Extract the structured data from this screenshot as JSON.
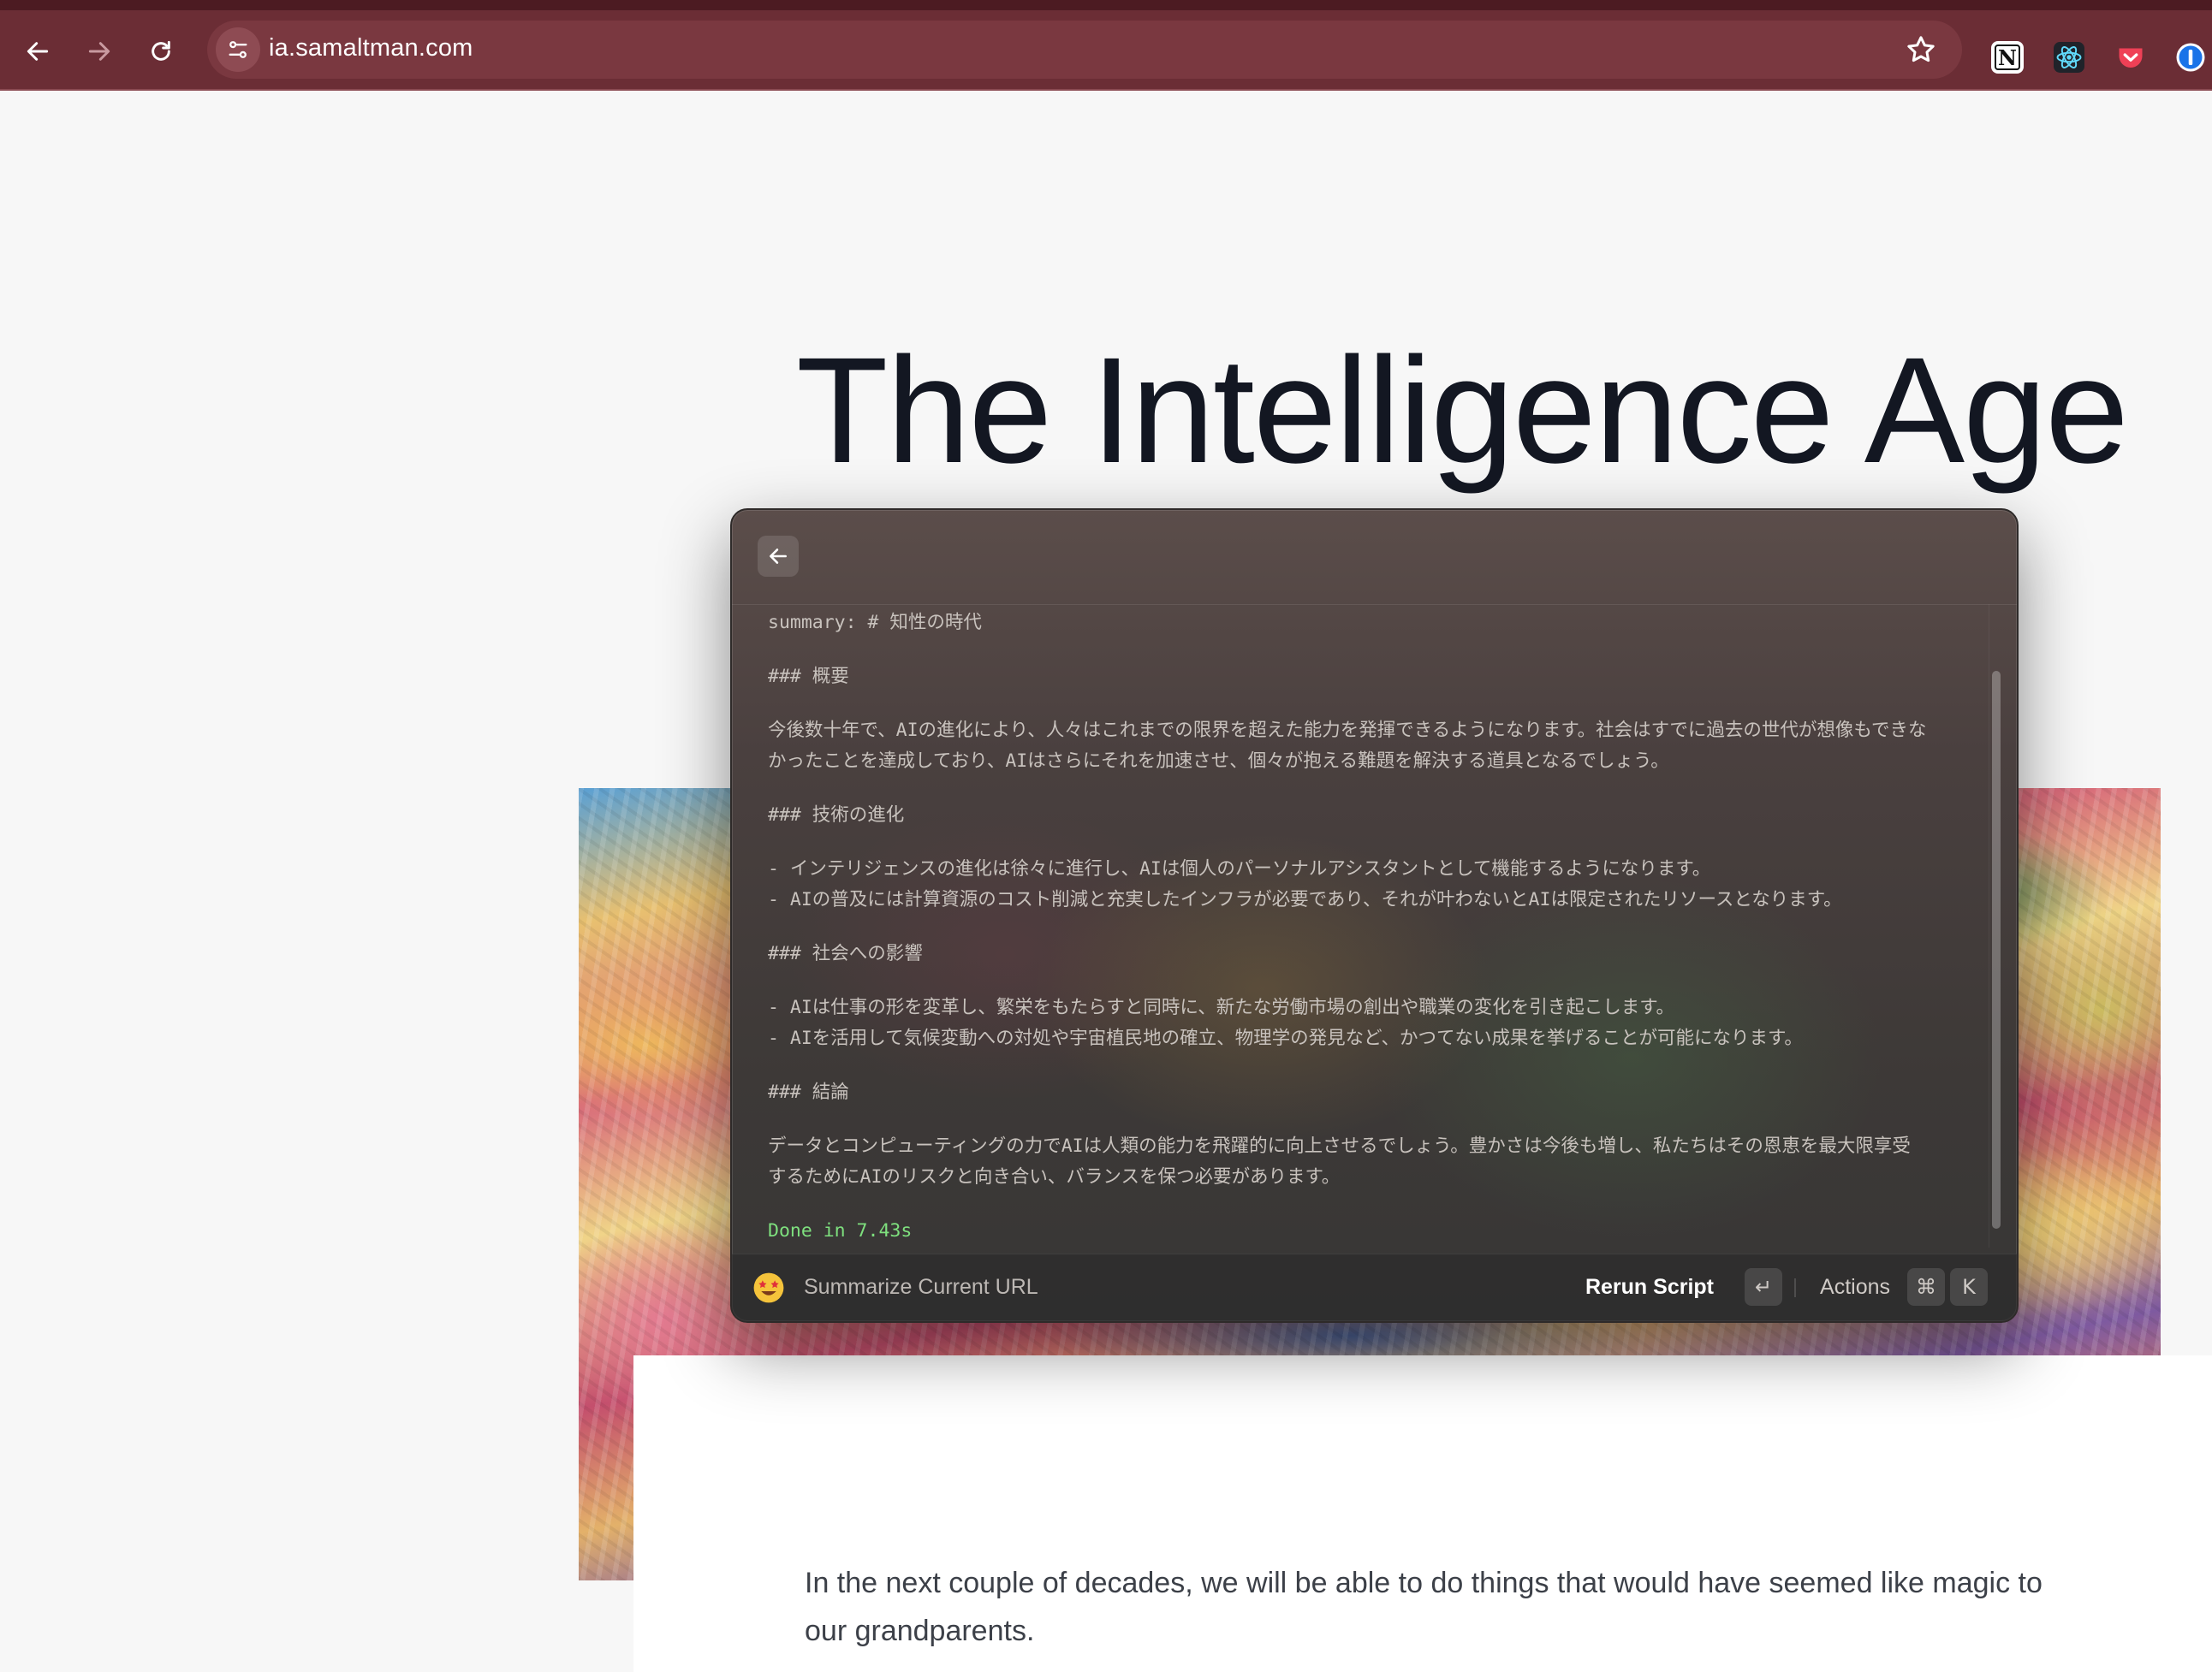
{
  "browser": {
    "url": "ia.samaltman.com",
    "extensions": [
      "notion-icon",
      "react-devtools-icon",
      "pocket-icon",
      "1password-icon"
    ]
  },
  "page": {
    "title": "The Intelligence Age",
    "body_text": "In the next couple of decades, we will be able to do things that would have seemed like magic to our grandparents."
  },
  "launcher": {
    "output_lines": [
      "summary: # 知性の時代",
      "",
      "### 概要",
      "",
      "今後数十年で、AIの進化により、人々はこれまでの限界を超えた能力を発揮できるようになります。社会はすでに過去の世代が想像もできな",
      "かったことを達成しており、AIはさらにそれを加速させ、個々が抱える難題を解決する道具となるでしょう。",
      "",
      "### 技術の進化",
      "",
      "- インテリジェンスの進化は徐々に進行し、AIは個人のパーソナルアシスタントとして機能するようになります。",
      "- AIの普及には計算資源のコスト削減と充実したインフラが必要であり、それが叶わないとAIは限定されたリソースとなります。",
      "",
      "### 社会への影響",
      "",
      "- AIは仕事の形を変革し、繁栄をもたらすと同時に、新たな労働市場の創出や職業の変化を引き起こします。",
      "- AIを活用して気候変動への対処や宇宙植民地の確立、物理学の発見など、かつてない成果を挙げることが可能になります。",
      "",
      "### 結論",
      "",
      "データとコンピューティングの力でAIは人類の能力を飛躍的に向上させるでしょう。豊かさは今後も増し、私たちはその恩恵を最大限享受",
      "するためにAIのリスクと向き合い、バランスを保つ必要があります。",
      "",
      "Done in 7.43s"
    ],
    "command_name": "Summarize Current URL",
    "primary_action": "Rerun Script",
    "primary_key": "↵",
    "secondary_action": "Actions",
    "secondary_keys": [
      "⌘",
      "K"
    ]
  },
  "colors": {
    "toolbar": "#6b2d35",
    "done": "#7ee07e"
  }
}
